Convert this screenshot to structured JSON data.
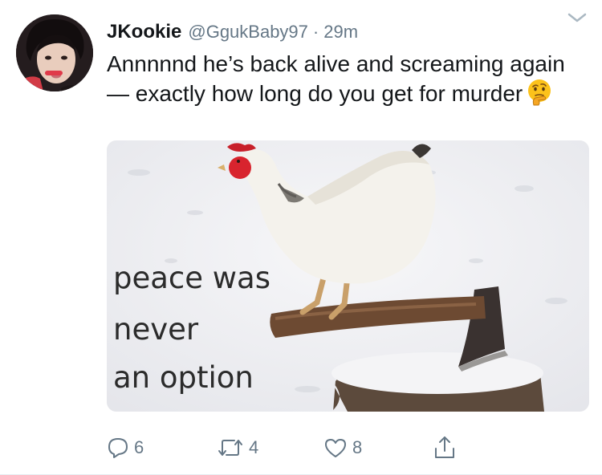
{
  "tweet": {
    "display_name": "JKookie",
    "handle": "@GgukBaby97",
    "separator": "·",
    "time": "29m",
    "text": "Annnnnd he’s back alive and screaming again — exactly how long do you get for murder",
    "emoji": "thinking-face-icon"
  },
  "media": {
    "caption_lines": [
      "peace was",
      "never",
      "an option"
    ]
  },
  "actions": {
    "replies": "6",
    "retweets": "4",
    "likes": "8"
  },
  "colors": {
    "text": "#14171a",
    "secondary": "#657786",
    "divider": "#e6ecf0"
  }
}
